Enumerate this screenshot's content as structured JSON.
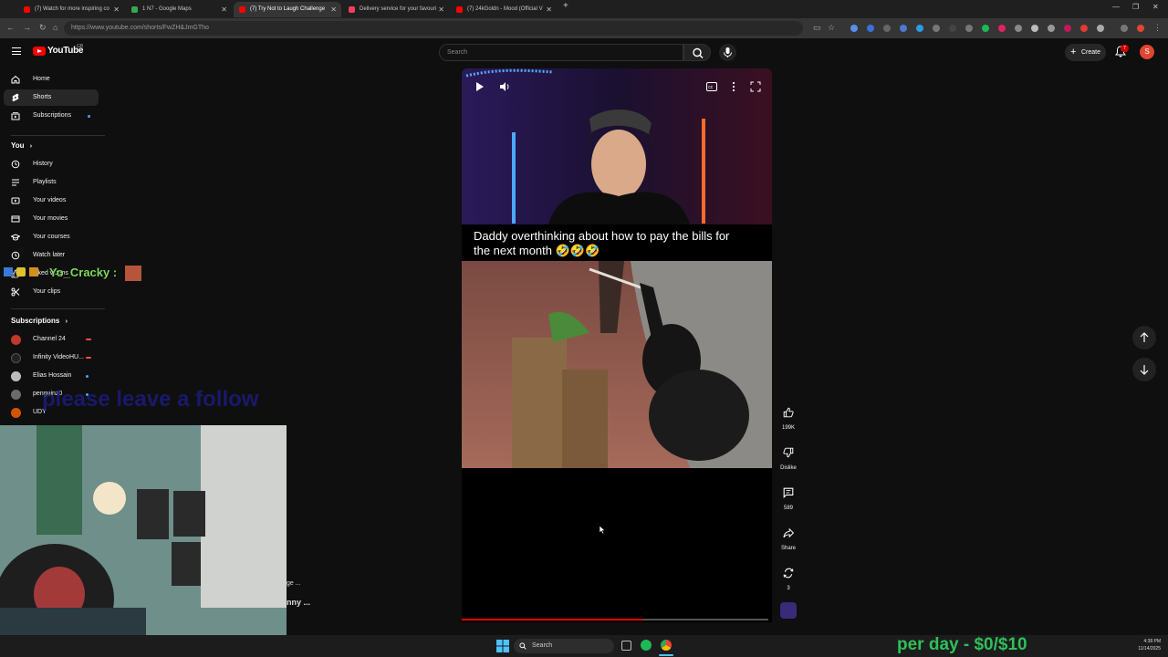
{
  "browser": {
    "tabs": [
      {
        "title": "(7) Watch for more inspiring co",
        "color": "#ff0000"
      },
      {
        "title": "1 N7 - Google Maps",
        "color": "#34a853"
      },
      {
        "title": "(7) Try Not to Laugh Challenge",
        "color": "#ff0000"
      },
      {
        "title": "Delivery service for your favouri",
        "color": "#ff3c5a"
      },
      {
        "title": "(7) 24kGoldn - Mood (Official V",
        "color": "#ff0000"
      }
    ],
    "new_tab_label": "+",
    "url": "https://www.youtube.com/shorts/FwZH&JmGTho"
  },
  "header": {
    "logo_text": "YouTube",
    "region": "GB",
    "search_placeholder": "Search",
    "create_label": "Create",
    "notification_count": "7",
    "avatar_letter": "S"
  },
  "sidebar": {
    "main": [
      {
        "label": "Home",
        "icon": "home-icon"
      },
      {
        "label": "Shorts",
        "icon": "shorts-icon",
        "active": true
      },
      {
        "label": "Subscriptions",
        "icon": "subscriptions-icon"
      }
    ],
    "you_heading": "You",
    "you_items": [
      {
        "label": "History",
        "icon": "history-icon"
      },
      {
        "label": "Playlists",
        "icon": "playlists-icon"
      },
      {
        "label": "Your videos",
        "icon": "your-videos-icon"
      },
      {
        "label": "Your movies",
        "icon": "your-movies-icon"
      },
      {
        "label": "Your courses",
        "icon": "your-courses-icon"
      },
      {
        "label": "Watch later",
        "icon": "watch-later-icon"
      },
      {
        "label": "Liked videos",
        "icon": "liked-videos-icon"
      },
      {
        "label": "Your clips",
        "icon": "clips-icon"
      }
    ],
    "subscriptions_heading": "Subscriptions",
    "subscriptions": [
      {
        "label": "Channel 24",
        "avatar_color": "#c0392b",
        "indicator": "live"
      },
      {
        "label": "Infinity VideoHU...",
        "avatar_color": "#222222",
        "indicator": "live"
      },
      {
        "label": "Elias Hossain",
        "avatar_color": "#bbbbbb",
        "indicator": "new"
      },
      {
        "label": "penguinz0",
        "avatar_color": "#6b6b6b",
        "indicator": "new"
      },
      {
        "label": "UDY",
        "avatar_color": "#d35400",
        "indicator": "none"
      }
    ]
  },
  "overlays": {
    "chat_name": "Yo_Cracky :",
    "follow_text": "please leave a follow",
    "goal_text": "per day - $0/$10",
    "cut_text_1": "ge ...",
    "cut_text_2": "nny ..."
  },
  "short": {
    "caption": "Daddy overthinking about how to pay the bills for the next month 🤣🤣🤣",
    "progress_fraction": 0.59
  },
  "actions": {
    "like_count": "199K",
    "dislike_label": "Dislike",
    "comment_count": "589",
    "share_label": "Share",
    "remix_count": "3"
  },
  "taskbar": {
    "search_label": "Search",
    "time": "4:38 PM",
    "date": "11/14/2025"
  }
}
